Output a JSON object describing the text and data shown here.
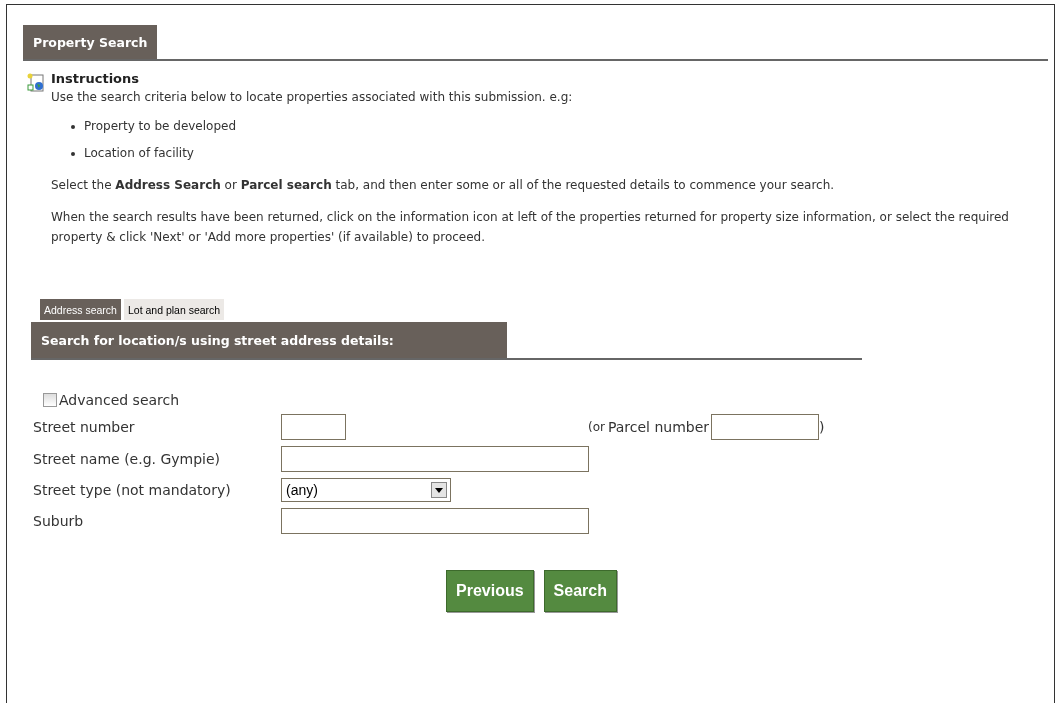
{
  "header": {
    "title": "Property Search"
  },
  "instructions": {
    "title": "Instructions",
    "intro": "Use the search criteria below to locate properties associated with this submission. e.g:",
    "bullets": [
      "Property to be developed",
      "Location of facility"
    ],
    "paragraphs": [
      "Select the **Address Search** or **Parcel search** tab, and then enter some or all of the requested details to commence your search.",
      "When the search results have been returned, click on the information icon at left of the properties returned for property size information, or select the required property & click 'Next' or 'Add more properties' (if available) to proceed."
    ]
  },
  "tabs": [
    {
      "label": "Address search",
      "selected": true
    },
    {
      "label": "Lot and plan search",
      "selected": false
    }
  ],
  "section": {
    "title": "Search for location/s using street address details:"
  },
  "advanced": {
    "label": "Advanced search",
    "checked": false
  },
  "fields": [
    {
      "kind": "short",
      "label": "Street number",
      "extra_prefix": "(or",
      "extra_label": "Parcel number",
      "extra_suffix": ")"
    },
    {
      "kind": "text",
      "label": "Street name (e.g. Gympie)"
    },
    {
      "kind": "select",
      "label": "Street type (not mandatory)",
      "value": "(any)"
    },
    {
      "kind": "text",
      "label": "Suburb"
    }
  ],
  "buttons": [
    "Previous",
    "Search"
  ]
}
